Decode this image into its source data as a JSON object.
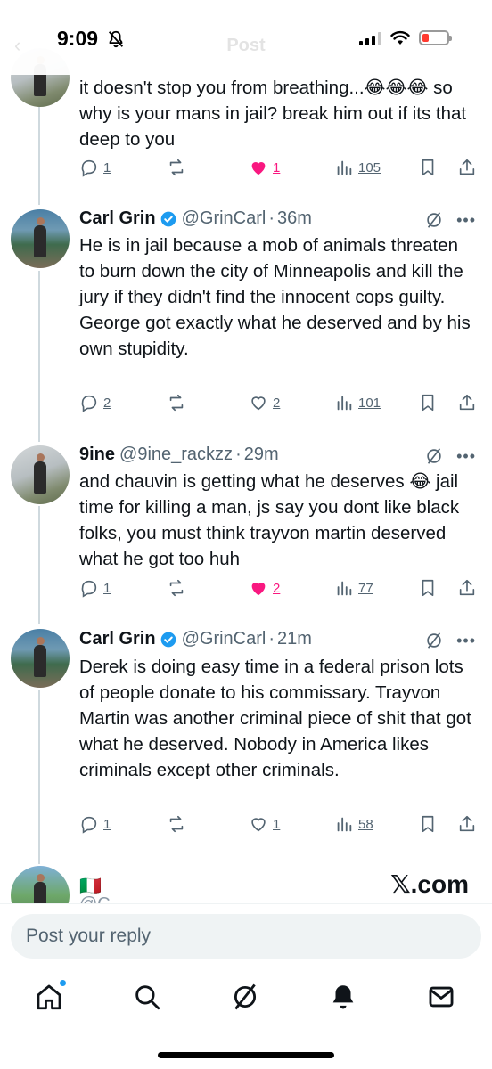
{
  "status_bar": {
    "time": "9:09"
  },
  "header": {
    "title": "Post",
    "back": "‹"
  },
  "tweets": [
    {
      "text": "it doesn't stop you from breathing...😂😂😂 so why is your mans in jail? break him out if its that deep to you",
      "replies": "1",
      "likes": "1",
      "liked": true,
      "views": "105"
    },
    {
      "name": "Carl Grin",
      "verified": true,
      "handle": "@GrinCarl",
      "time": "36m",
      "text": "He is in jail because a mob of animals threaten to burn down the city of Minneapolis and kill the jury if they didn't find the innocent cops guilty. George got exactly what he deserved and by his own stupidity.",
      "replies": "2",
      "likes": "2",
      "liked": false,
      "views": "101"
    },
    {
      "name": "9ine",
      "verified": false,
      "handle": "@9ine_rackzz",
      "time": "29m",
      "text": "and chauvin is getting what he deserves 😂 jail time for killing a man, js say you dont like black folks, you must think trayvon martin deserved what he got too huh",
      "replies": "1",
      "likes": "2",
      "liked": true,
      "views": "77"
    },
    {
      "name": "Carl Grin",
      "verified": true,
      "handle": "@GrinCarl",
      "time": "21m",
      "text": "Derek is doing easy time in a federal prison lots of people donate to his commissary. Trayvon Martin was another criminal piece of shit that got what he deserved. Nobody in America likes criminals except other criminals.",
      "replies": "1",
      "likes": "1",
      "liked": false,
      "views": "58"
    },
    {
      "name": "🇮🇹",
      "handle": "@C...",
      "time": ""
    }
  ],
  "separator": "·",
  "watermark": {
    "x": "𝕏",
    "domain": ".com"
  },
  "composer": {
    "placeholder": "Post your reply"
  },
  "colors": {
    "accent": "#1d9bf0",
    "like": "#f91880",
    "secondary": "#536471"
  },
  "icons": {
    "reply": "reply-icon",
    "repost": "repost-icon",
    "like": "heart-icon",
    "views": "views-icon",
    "bookmark": "bookmark-icon",
    "share": "share-icon",
    "grok": "grok-icon",
    "more": "more-icon",
    "tabs": [
      "home-icon",
      "search-icon",
      "grok-icon",
      "notifications-icon",
      "messages-icon"
    ]
  }
}
